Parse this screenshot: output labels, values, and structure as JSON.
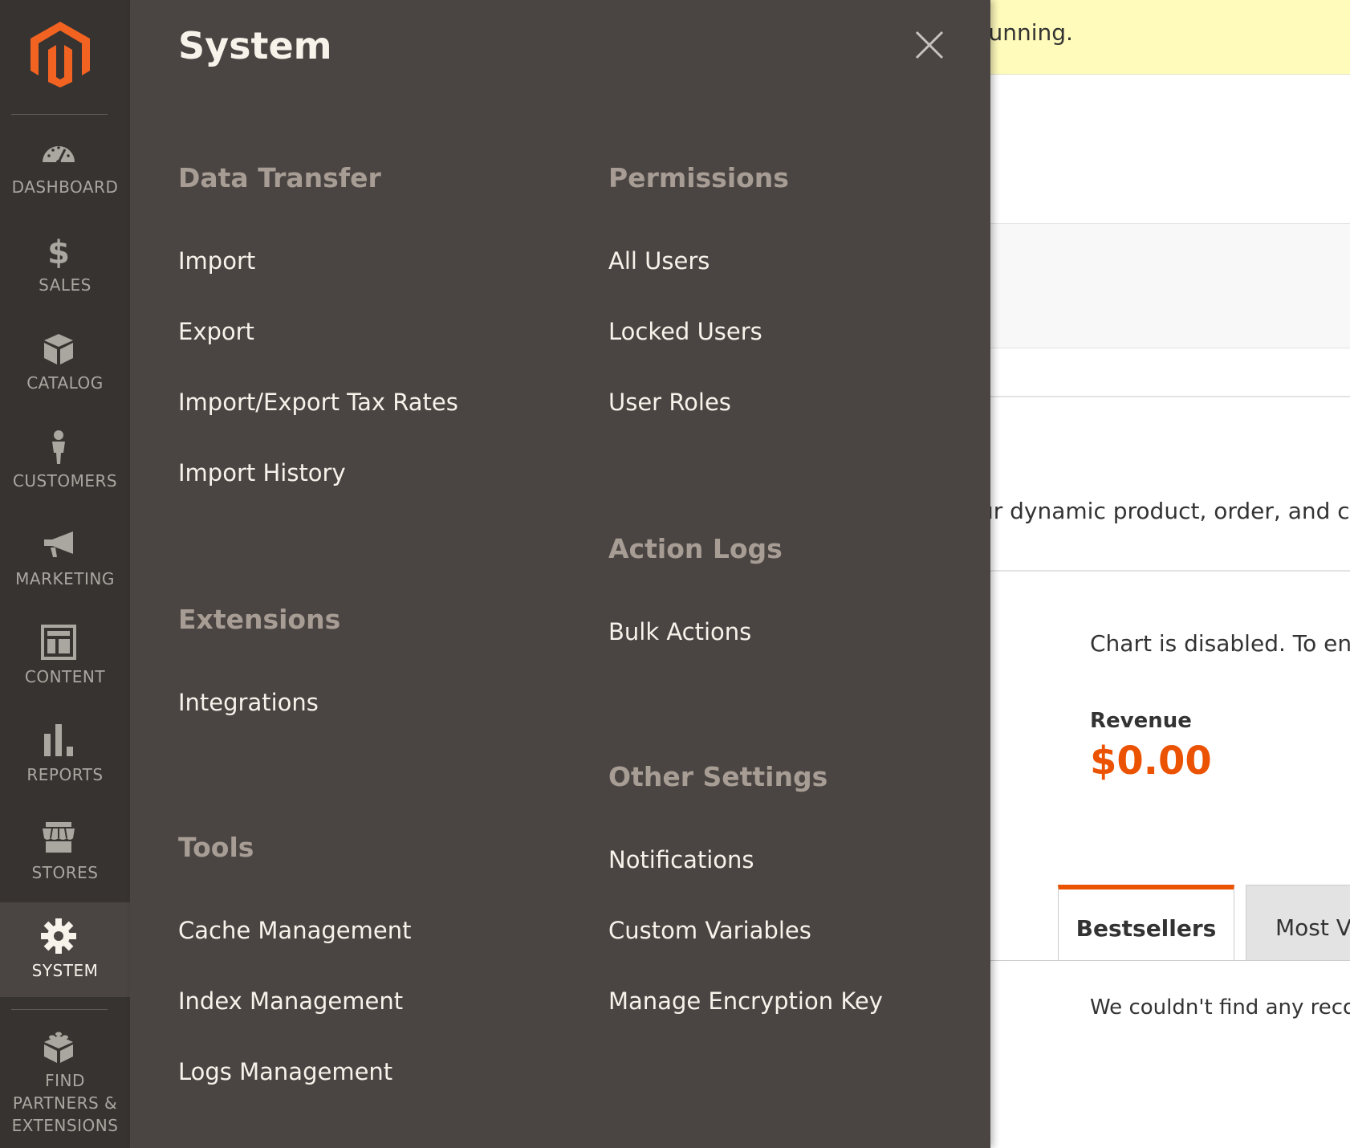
{
  "background": {
    "notice_text": "running.",
    "dynamic_text": "ur dynamic product, order, and cus",
    "chart_disabled_text": "Chart is disabled. To enal",
    "revenue_label": "Revenue",
    "revenue_value": "$0.00",
    "tabs": [
      "Bestsellers",
      "Most V"
    ],
    "no_records_text": "We couldn't find any record"
  },
  "sidebar": {
    "items": [
      {
        "label": "DASHBOARD",
        "icon": "dashboard-gauge-icon"
      },
      {
        "label": "SALES",
        "icon": "dollar-icon"
      },
      {
        "label": "CATALOG",
        "icon": "box-icon"
      },
      {
        "label": "CUSTOMERS",
        "icon": "person-icon"
      },
      {
        "label": "MARKETING",
        "icon": "megaphone-icon"
      },
      {
        "label": "CONTENT",
        "icon": "layout-icon"
      },
      {
        "label": "REPORTS",
        "icon": "bar-chart-icon"
      },
      {
        "label": "STORES",
        "icon": "storefront-icon"
      },
      {
        "label": "SYSTEM",
        "icon": "gear-icon",
        "active": true
      },
      {
        "label": "FIND PARTNERS & EXTENSIONS",
        "icon": "blocks-icon"
      }
    ]
  },
  "flyout": {
    "title": "System",
    "left_column": [
      {
        "heading": "Data Transfer",
        "links": [
          "Import",
          "Export",
          "Import/Export Tax Rates",
          "Import History"
        ]
      },
      {
        "heading": "Extensions",
        "links": [
          "Integrations"
        ]
      },
      {
        "heading": "Tools",
        "links": [
          "Cache Management",
          "Index Management",
          "Logs Management"
        ]
      }
    ],
    "right_column": [
      {
        "heading": "Permissions",
        "links": [
          "All Users",
          "Locked Users",
          "User Roles"
        ]
      },
      {
        "heading": "Action Logs",
        "links": [
          "Bulk Actions"
        ]
      },
      {
        "heading": "Other Settings",
        "links": [
          "Notifications",
          "Custom Variables",
          "Manage Encryption Key"
        ]
      }
    ]
  },
  "colors": {
    "sidebar_bg": "#373330",
    "flyout_bg": "#4a4542",
    "accent": "#eb5202",
    "heading": "#a79d95"
  }
}
